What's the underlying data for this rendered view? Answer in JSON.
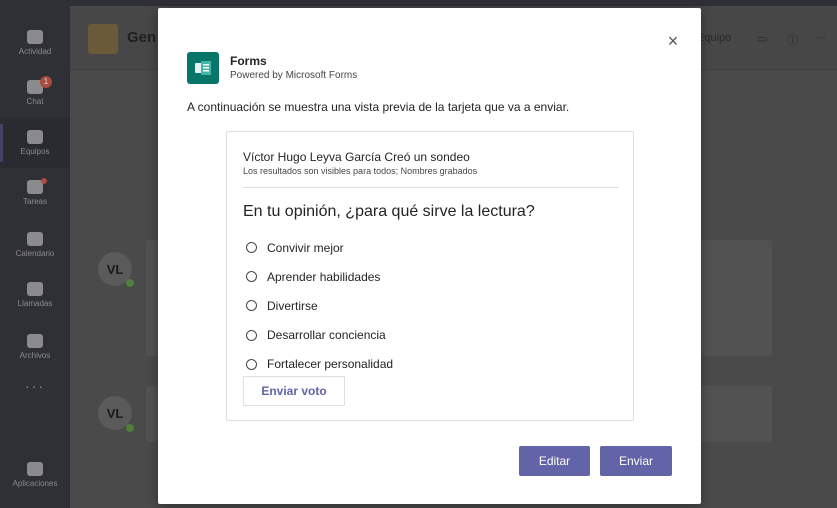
{
  "rail": {
    "items": [
      {
        "label": "Actividad"
      },
      {
        "label": "Chat",
        "badge": "1"
      },
      {
        "label": "Equipos"
      },
      {
        "label": "Tareas"
      },
      {
        "label": "Calendario"
      },
      {
        "label": "Llamadas"
      },
      {
        "label": "Archivos"
      }
    ],
    "more": "···",
    "apps": "Aplicaciones"
  },
  "background": {
    "team_name": "Gen",
    "header_team_link": "Equipo",
    "avatar_initials": "VL"
  },
  "dialog": {
    "close_glyph": "×",
    "app_name": "Forms",
    "app_subtitle": "Powered by Microsoft Forms",
    "preview_notice": "A continuación se muestra una vista previa de la tarjeta que va a enviar.",
    "card": {
      "creator_line": "Víctor Hugo Leyva García Creó un sondeo",
      "visibility_line": "Los resultados son visibles para todos; Nombres grabados",
      "question": "En tu opinión, ¿para qué sirve la lectura?",
      "options": [
        "Convivir mejor",
        "Aprender habilidades",
        "Divertirse",
        "Desarrollar conciencia",
        "Fortalecer personalidad"
      ],
      "vote_button": "Enviar voto"
    },
    "edit_button": "Editar",
    "send_button": "Enviar"
  },
  "colors": {
    "accent": "#6264a7",
    "forms_brand": "#077568"
  }
}
